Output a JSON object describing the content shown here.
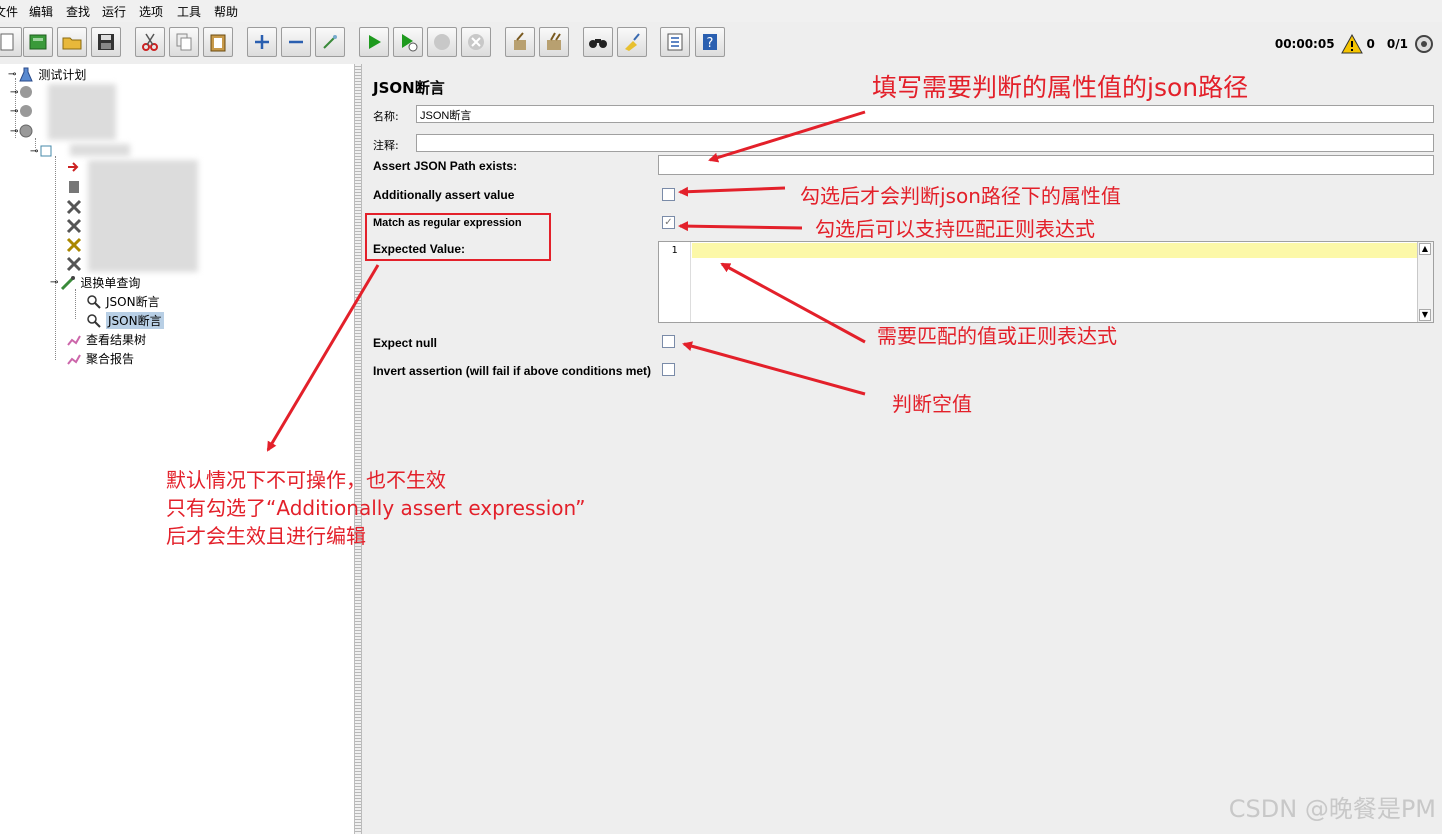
{
  "menu": [
    "文件",
    "编辑",
    "查找",
    "运行",
    "选项",
    "工具",
    "帮助"
  ],
  "menu_visible": [
    "文件",
    "编辑",
    "查找",
    "运行",
    "选项",
    "工具",
    "帮助"
  ],
  "status": {
    "timer": "00:00:05",
    "warnings": "0",
    "threads": "0/1"
  },
  "tree": {
    "root": "测试计划",
    "sampler": "退换单查询",
    "assert1": "JSON断言",
    "assert2": "JSON断言",
    "listener1": "查看结果树",
    "listener2": "聚合报告"
  },
  "panel": {
    "title": "JSON断言",
    "name_label": "名称:",
    "name_value": "JSON断言",
    "comment_label": "注释:",
    "path_label": "Assert JSON Path exists:",
    "additional_label": "Additionally assert value",
    "regex_label": "Match as regular expression",
    "expected_label": "Expected Value:",
    "line_number": "1",
    "expect_null_label": "Expect null",
    "invert_label": "Invert assertion (will fail if above conditions met)"
  },
  "annotations": {
    "a1": "填写需要判断的属性值的json路径",
    "a2": "勾选后才会判断json路径下的属性值",
    "a3": "勾选后可以支持匹配正则表达式",
    "a4": "需要匹配的值或正则表达式",
    "a5": "判断空值",
    "a6_line1": "默认情况下不可操作，也不生效",
    "a6_line2": "只有勾选了“Additionally assert expression”",
    "a6_line3": "后才会生效且进行编辑"
  },
  "watermark": "CSDN @晚餐是PM",
  "accent_color": "#e3202a"
}
